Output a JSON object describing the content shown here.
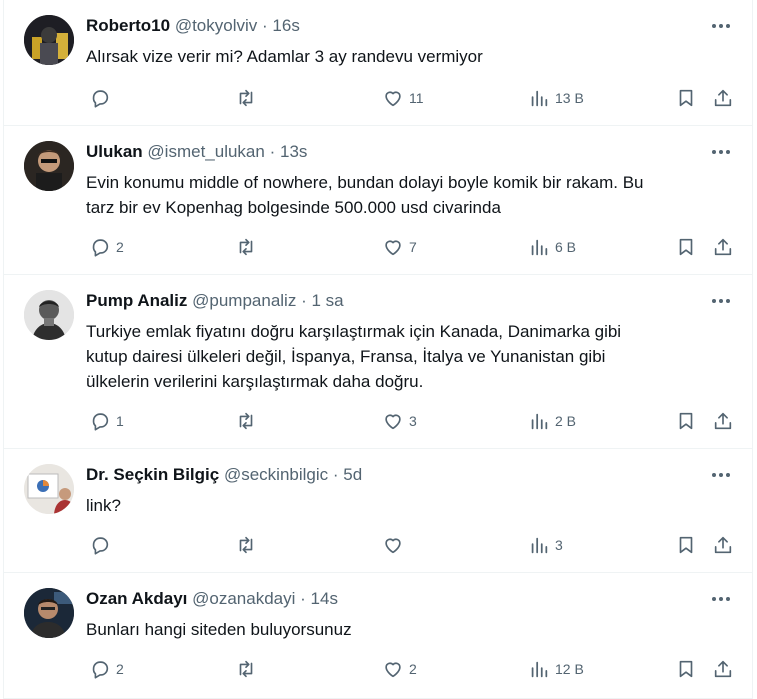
{
  "tweets": [
    {
      "name": "Roberto10",
      "handle": "@tokyolviv",
      "time": "16s",
      "lines": [
        "Alırsak vize verir mi? Adamlar 3 ay randevu vermiyor"
      ],
      "replies": "",
      "likes": "11",
      "views": "13 B"
    },
    {
      "name": "Ulukan",
      "handle": "@ismet_ulukan",
      "time": "13s",
      "lines": [
        "Evin konumu middle of nowhere, bundan dolayi boyle komik bir rakam. Bu",
        "tarz bir ev Kopenhag bolgesinde 500.000 usd civarinda"
      ],
      "replies": "2",
      "likes": "7",
      "views": "6 B"
    },
    {
      "name": "Pump Analiz",
      "handle": "@pumpanaliz",
      "time": "1 sa",
      "lines": [
        "Turkiye emlak fiyatını doğru karşılaştırmak için Kanada, Danimarka gibi",
        "kutup dairesi ülkeleri değil, İspanya, Fransa, İtalya ve Yunanistan gibi",
        "ülkelerin verilerini karşılaştırmak daha doğru."
      ],
      "replies": "1",
      "likes": "3",
      "views": "2 B"
    },
    {
      "name": "Dr. Seçkin Bilgiç",
      "handle": "@seckinbilgic",
      "time": "5d",
      "lines": [
        "link?"
      ],
      "replies": "",
      "likes": "",
      "views": "3"
    },
    {
      "name": "Ozan Akdayı",
      "handle": "@ozanakdayi",
      "time": "14s",
      "lines": [
        "Bunları hangi siteden buluyorsunuz"
      ],
      "replies": "2",
      "likes": "2",
      "views": "12 B"
    }
  ],
  "separator": "·",
  "icons": [
    "more-icon",
    "reply-icon",
    "retweet-icon",
    "like-icon",
    "views-icon",
    "bookmark-icon",
    "share-icon"
  ],
  "colors": {
    "text": "#0f1419",
    "secondary": "#536471",
    "divider": "#eff3f4"
  }
}
